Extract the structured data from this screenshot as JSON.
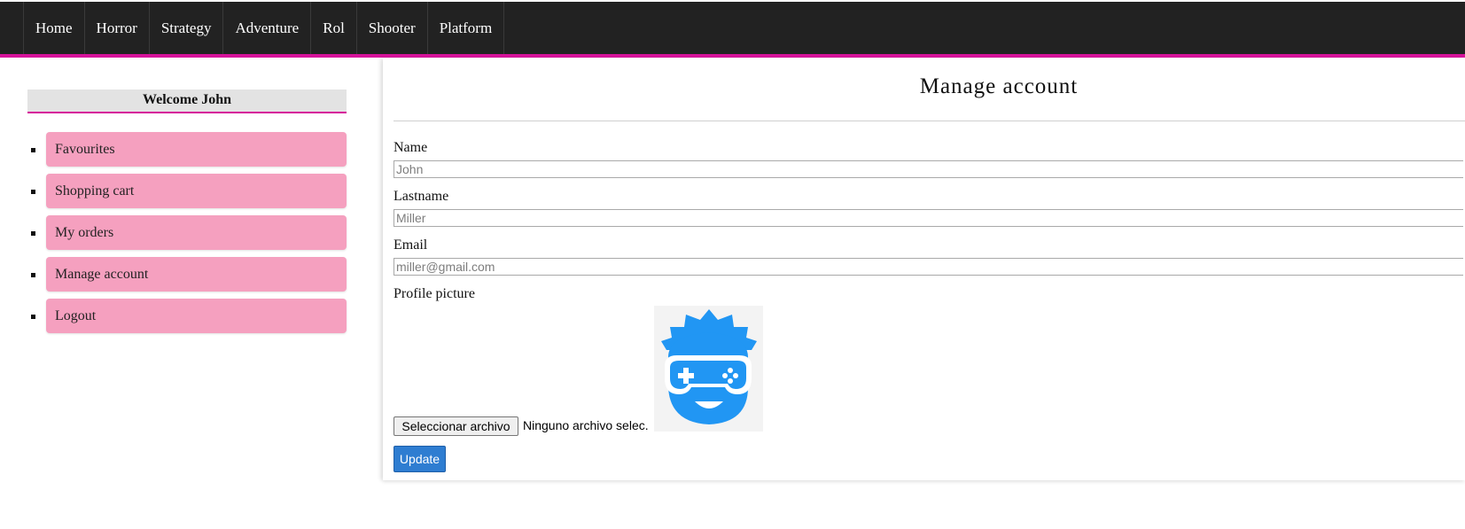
{
  "colors": {
    "navbar_bg": "#222222",
    "accent_pink": "#d6119a",
    "menu_item_bg": "#f5a0bf",
    "update_button_bg": "#2e7dd1",
    "avatar_blue": "#2196f3"
  },
  "navbar": {
    "items": [
      {
        "label": "Home"
      },
      {
        "label": "Horror"
      },
      {
        "label": "Strategy"
      },
      {
        "label": "Adventure"
      },
      {
        "label": "Rol"
      },
      {
        "label": "Shooter"
      },
      {
        "label": "Platform"
      }
    ]
  },
  "sidebar": {
    "welcome": "Welcome John",
    "items": [
      {
        "label": "Favourites"
      },
      {
        "label": "Shopping cart"
      },
      {
        "label": "My orders"
      },
      {
        "label": "Manage account"
      },
      {
        "label": "Logout"
      }
    ]
  },
  "main": {
    "title": "Manage account",
    "fields": {
      "name": {
        "label": "Name",
        "placeholder": "John"
      },
      "lastname": {
        "label": "Lastname",
        "placeholder": "Miller"
      },
      "email": {
        "label": "Email",
        "placeholder": "miller@gmail.com"
      }
    },
    "profile_picture": {
      "label": "Profile picture",
      "avatar_icon": "gamer-avatar-icon",
      "file_button": "Seleccionar archivo",
      "file_status": "Ninguno archivo selec."
    },
    "update_button": "Update"
  }
}
